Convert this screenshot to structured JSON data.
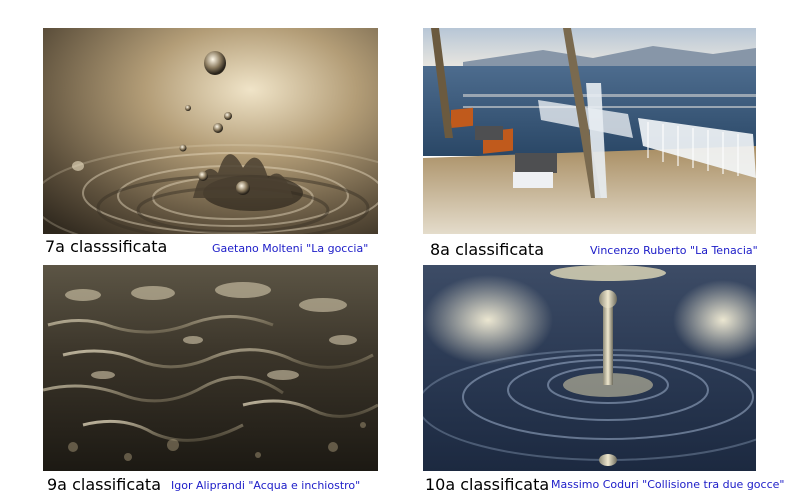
{
  "entries": [
    {
      "rank": "7a classsificata",
      "credit": "Gaetano Molteni \"La goccia\""
    },
    {
      "rank": "8a classificata",
      "credit": "Vincenzo Ruberto \"La Tenacia\""
    },
    {
      "rank": "9a classificata",
      "credit": "Igor Aliprandi \"Acqua e inchiostro\""
    },
    {
      "rank": "10a classificata",
      "credit": "Massimo Coduri \"Collisione tra due gocce\""
    }
  ],
  "colors": {
    "credit_text": "#1c1cc8",
    "rank_text": "#000000",
    "background": "#ffffff"
  }
}
